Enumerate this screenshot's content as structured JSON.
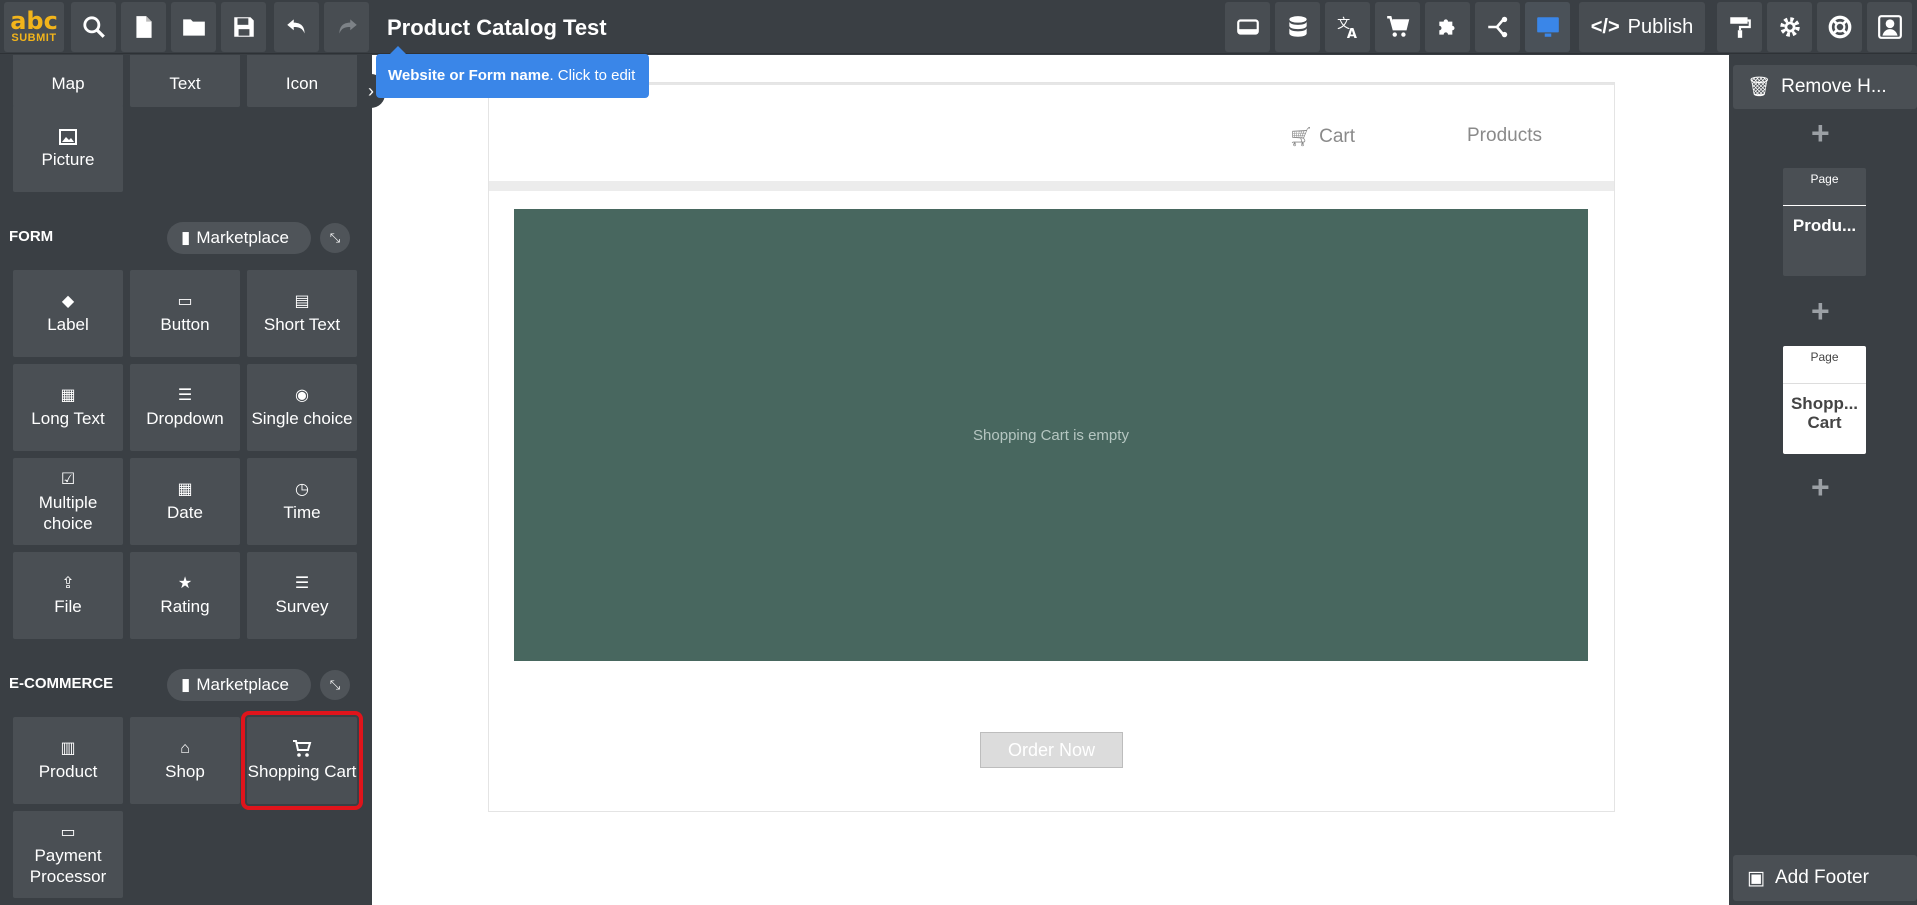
{
  "app": {
    "logo_line1": "abc",
    "logo_line2": "SUBMIT",
    "title": "Product Catalog Test",
    "publish_label": "Publish",
    "tooltip_bold": "Website or Form name",
    "tooltip_rest": ". Click to edit"
  },
  "toolbar_left": [
    {
      "name": "search-icon"
    },
    {
      "name": "new-file-icon"
    },
    {
      "name": "open-folder-icon"
    },
    {
      "name": "save-icon"
    },
    {
      "name": "undo-icon"
    },
    {
      "name": "redo-icon"
    }
  ],
  "toolbar_right": [
    {
      "name": "header-footer-icon"
    },
    {
      "name": "database-icon"
    },
    {
      "name": "translate-icon"
    },
    {
      "name": "cart-icon"
    },
    {
      "name": "puzzle-icon"
    },
    {
      "name": "flow-icon"
    },
    {
      "name": "desktop-view-icon"
    },
    {
      "name": "paint-roller-icon"
    },
    {
      "name": "gear-icon"
    },
    {
      "name": "help-lifebuoy-icon"
    },
    {
      "name": "account-icon"
    }
  ],
  "left_panel": {
    "top_tiles": [
      "Map",
      "Text",
      "Icon"
    ],
    "picture_tile": "Picture",
    "form_section": {
      "label": "FORM",
      "marketplace": "Marketplace",
      "tiles": [
        "Label",
        "Button",
        "Short Text",
        "Long Text",
        "Dropdown",
        "Single choice",
        "Multiple choice",
        "Date",
        "Time",
        "File",
        "Rating",
        "Survey"
      ]
    },
    "ecommerce_section": {
      "label": "E-COMMERCE",
      "marketplace": "Marketplace",
      "tiles": [
        "Product",
        "Shop",
        "Shopping Cart",
        "Payment Processor"
      ]
    }
  },
  "canvas": {
    "nav_cart": "Cart",
    "nav_products": "Products",
    "cart_empty": "Shopping Cart is empty",
    "order_button": "Order Now"
  },
  "right_panel": {
    "remove_header": "Remove H...",
    "pages": [
      {
        "label": "Page",
        "name": "Produ..."
      },
      {
        "label": "Page",
        "name": "Shopp... Cart"
      }
    ],
    "add_footer": "Add Footer"
  },
  "colors": {
    "accent": "#3a86e8",
    "selection_outline": "#e0141b",
    "cart_area": "#48675f",
    "logo": "#f2b41b"
  }
}
